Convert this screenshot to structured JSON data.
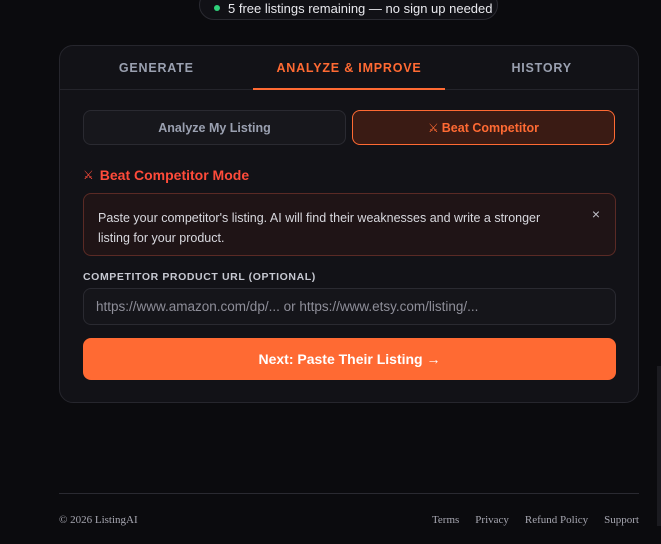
{
  "banner": {
    "text": "5 free listings remaining — no sign up needed",
    "dot_color": "#2fd17a"
  },
  "tabs": [
    {
      "label": "GENERATE"
    },
    {
      "label": "ANALYZE & IMPROVE",
      "active": true
    },
    {
      "label": "HISTORY"
    }
  ],
  "modes": {
    "analyze_label": "Analyze My Listing",
    "beat_label": "Beat Competitor"
  },
  "mode_title": "Beat Competitor Mode",
  "notice": {
    "text": "Paste your competitor's listing. AI will find their weaknesses and write a stronger listing for your product.",
    "close_glyph": "×"
  },
  "competitor": {
    "label": "COMPETITOR PRODUCT URL (OPTIONAL)",
    "placeholder": "https://www.amazon.com/dp/... or https://www.etsy.com/listing/..."
  },
  "next_button": "Next: Paste Their Listing →",
  "footer": {
    "copyright": "© 2026 ListingAI",
    "links": [
      "Terms",
      "Privacy",
      "Refund Policy",
      "Support"
    ]
  },
  "colors": {
    "accent": "#ff6a33",
    "danger": "#ff4b3a",
    "background": "#0b0b0e"
  },
  "icons": {
    "mode": "crossed-swords-icon",
    "close": "close-icon"
  }
}
